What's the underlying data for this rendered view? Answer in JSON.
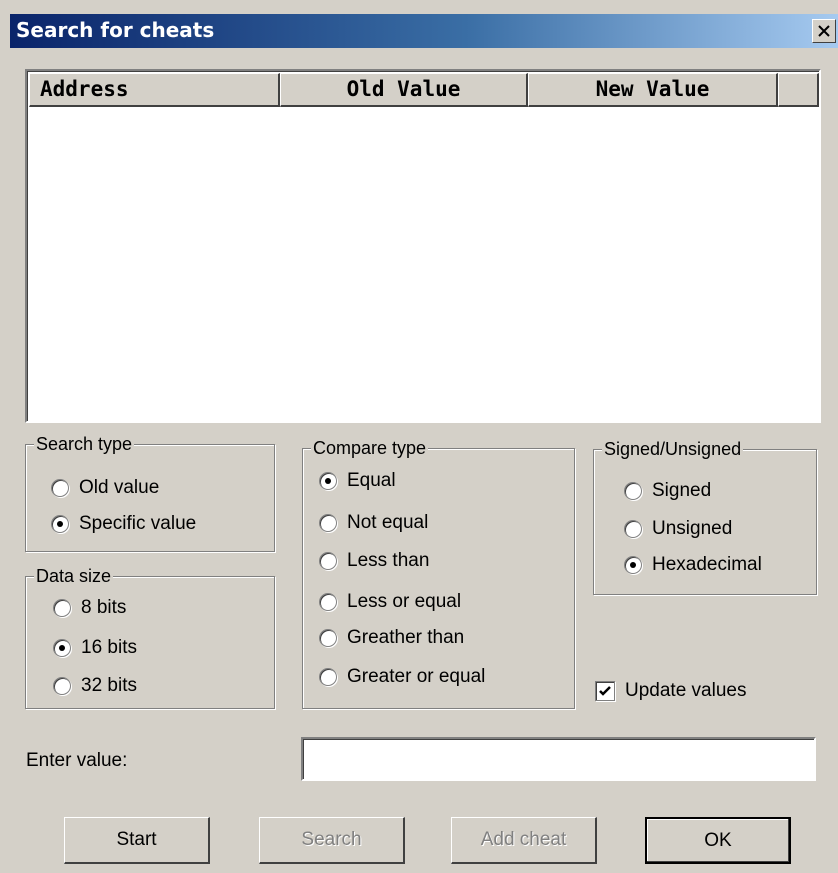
{
  "window": {
    "title": "Search for cheats"
  },
  "list": {
    "columns": [
      "Address",
      "Old Value",
      "New Value",
      ""
    ],
    "rows": []
  },
  "search_type": {
    "label": "Search type",
    "options": [
      "Old value",
      "Specific value"
    ],
    "selected": "Specific value"
  },
  "data_size": {
    "label": "Data size",
    "options": [
      "8 bits",
      "16 bits",
      "32 bits"
    ],
    "selected": "16 bits"
  },
  "compare_type": {
    "label": "Compare type",
    "options": [
      "Equal",
      "Not equal",
      "Less than",
      "Less or equal",
      "Greather than",
      "Greater or equal"
    ],
    "selected": "Equal"
  },
  "signed": {
    "label": "Signed/Unsigned",
    "options": [
      "Signed",
      "Unsigned",
      "Hexadecimal"
    ],
    "selected": "Hexadecimal"
  },
  "update_values": {
    "label": "Update values",
    "checked": true
  },
  "enter_value": {
    "label": "Enter value:",
    "value": ""
  },
  "buttons": {
    "start": "Start",
    "search": "Search",
    "add_cheat": "Add cheat",
    "ok": "OK"
  }
}
